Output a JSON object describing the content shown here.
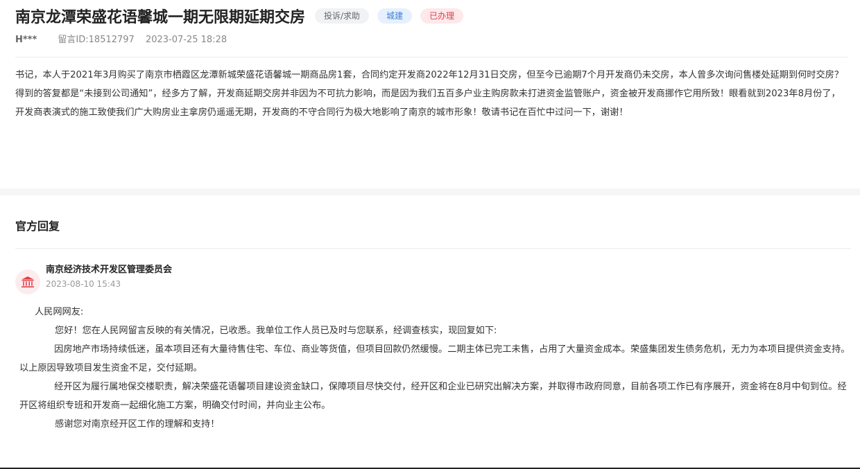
{
  "post": {
    "title": "南京龙潭荣盛花语馨城一期无限期延期交房",
    "tags": {
      "type": "投诉/求助",
      "category": "城建",
      "status": "已办理"
    },
    "author": "H***",
    "message_id": "留言ID:18512797",
    "date": "2023-07-25 18:28",
    "body": "书记，本人于2021年3月购买了南京市栖霞区龙潭新城荣盛花语馨城一期商品房1套，合同约定开发商2022年12月31日交房，但至今已逾期7个月开发商仍未交房，本人曾多次询问售楼处延期到何时交房？得到的答复都是“未接到公司通知”，经多方了解，开发商延期交房并非因为不可抗力影响，而是因为我们五百多户业主购房款未打进资金监管账户，资金被开发商挪作它用所致！眼看就到2023年8月份了，开发商表演式的施工致使我们广大购房业主拿房仍遥遥无期，开发商的不守合同行为极大地影响了南京的城市形象！敬请书记在百忙中过问一下，谢谢！"
  },
  "reply": {
    "heading": "官方回复",
    "responder": {
      "icon": "government-building-icon",
      "name": "南京经济技术开发区管理委员会",
      "date": "2023-08-10 15:43"
    },
    "greeting": "人民网网友:",
    "paragraphs": [
      "您好！您在人民网留言反映的有关情况，已收悉。我单位工作人员已及时与您联系，经调查核实，现回复如下:",
      "因房地产市场持续低迷，虽本项目还有大量待售住宅、车位、商业等货值，但项目回款仍然缓慢。二期主体已完工未售，占用了大量资金成本。荣盛集团发生债务危机，无力为本项目提供资金支持。以上原因导致项目发生资金不足，交付延期。",
      "经开区为履行属地保交楼职责，解决荣盛花语馨项目建设资金缺口，保障项目尽快交付，经开区和企业已研究出解决方案，并取得市政府同意，目前各项工作已有序展开，资金将在8月中旬到位。经开区将组织专班和开发商一起细化施工方案，明确交付时间，并向业主公布。",
      "感谢您对南京经开区工作的理解和支持！"
    ]
  },
  "colors": {
    "status_red": "#e0414a",
    "category_blue": "#3f7fd8",
    "icon_red": "#e0414a"
  }
}
